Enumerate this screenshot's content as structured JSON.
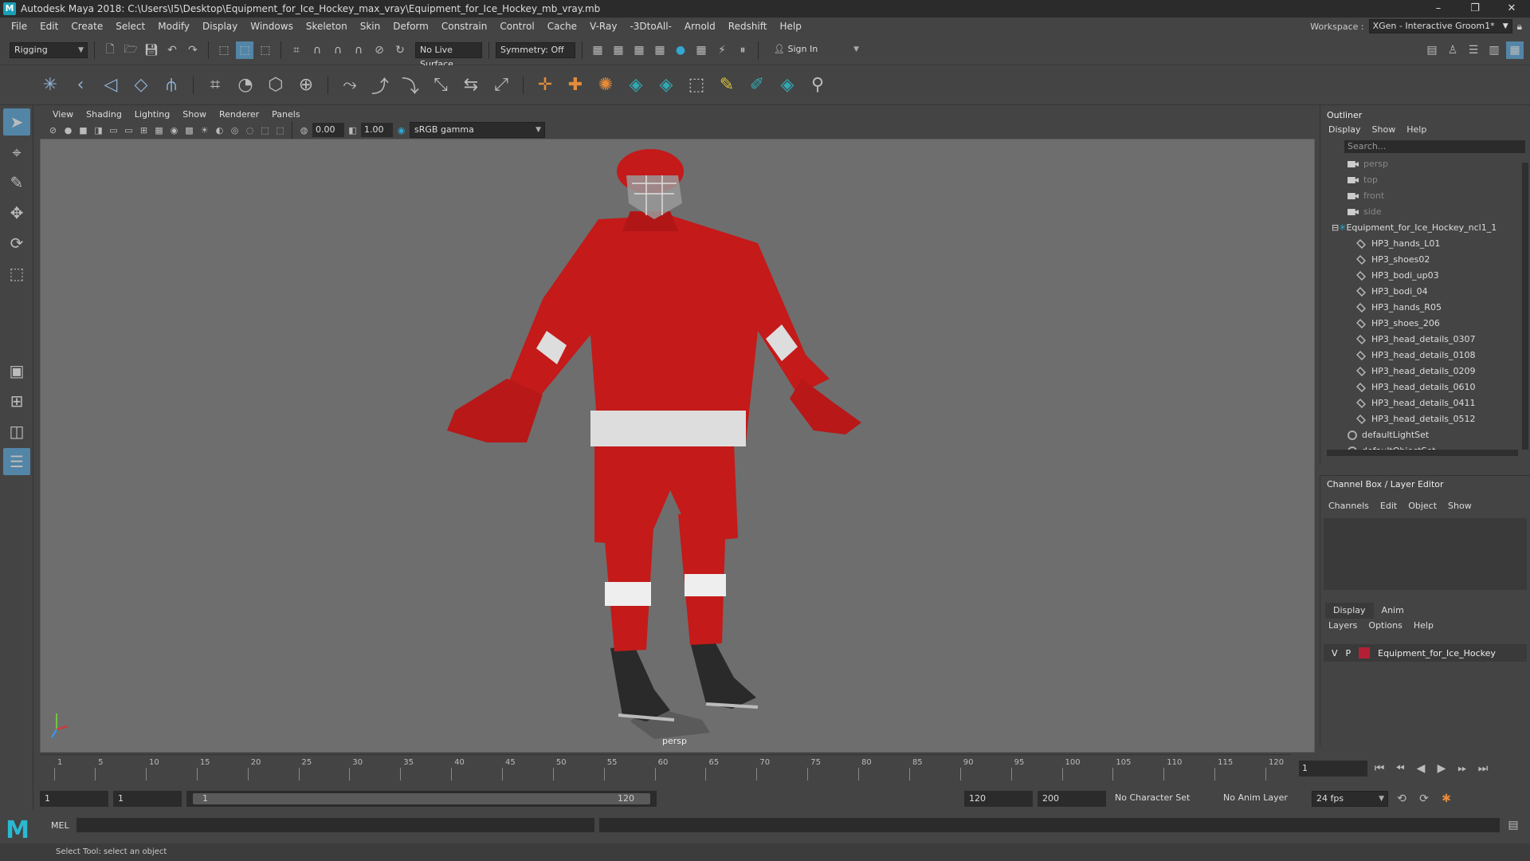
{
  "window": {
    "title": "Autodesk Maya 2018: C:\\Users\\I5\\Desktop\\Equipment_for_Ice_Hockey_max_vray\\Equipment_for_Ice_Hockey_mb_vray.mb",
    "minimize": "–",
    "maximize": "❐",
    "close": "✕"
  },
  "menu": [
    "File",
    "Edit",
    "Create",
    "Select",
    "Modify",
    "Display",
    "Windows",
    "Skeleton",
    "Skin",
    "Deform",
    "Constrain",
    "Control",
    "Cache",
    "V-Ray",
    "-3DtoAll-",
    "Arnold",
    "Redshift",
    "Help"
  ],
  "workspace": {
    "label": "Workspace :",
    "value": "XGen - Interactive Groom1*"
  },
  "status": {
    "mode": "Rigging",
    "live_surface": "No Live Surface",
    "symmetry": "Symmetry: Off",
    "sign_in": "Sign In"
  },
  "viewport": {
    "menu": [
      "View",
      "Shading",
      "Lighting",
      "Show",
      "Renderer",
      "Panels"
    ],
    "exposure": "0.00",
    "gamma": "1.00",
    "color_space": "sRGB gamma",
    "camera": "persp"
  },
  "outliner": {
    "title": "Outliner",
    "menu": [
      "Display",
      "Show",
      "Help"
    ],
    "search_placeholder": "Search...",
    "items": [
      {
        "label": "persp",
        "kind": "cam",
        "indent": 0
      },
      {
        "label": "top",
        "kind": "cam",
        "indent": 0
      },
      {
        "label": "front",
        "kind": "cam",
        "indent": 0
      },
      {
        "label": "side",
        "kind": "cam",
        "indent": 0
      },
      {
        "label": "Equipment_for_Ice_Hockey_ncl1_1",
        "kind": "group",
        "indent": 0
      },
      {
        "label": "HP3_hands_L01",
        "kind": "mesh",
        "indent": 1
      },
      {
        "label": "HP3_shoes02",
        "kind": "mesh",
        "indent": 1
      },
      {
        "label": "HP3_bodi_up03",
        "kind": "mesh",
        "indent": 1
      },
      {
        "label": "HP3_bodi_04",
        "kind": "mesh",
        "indent": 1
      },
      {
        "label": "HP3_hands_R05",
        "kind": "mesh",
        "indent": 1
      },
      {
        "label": "HP3_shoes_206",
        "kind": "mesh",
        "indent": 1
      },
      {
        "label": "HP3_head_details_0307",
        "kind": "mesh",
        "indent": 1
      },
      {
        "label": "HP3_head_details_0108",
        "kind": "mesh",
        "indent": 1
      },
      {
        "label": "HP3_head_details_0209",
        "kind": "mesh",
        "indent": 1
      },
      {
        "label": "HP3_head_details_0610",
        "kind": "mesh",
        "indent": 1
      },
      {
        "label": "HP3_head_details_0411",
        "kind": "mesh",
        "indent": 1
      },
      {
        "label": "HP3_head_details_0512",
        "kind": "mesh",
        "indent": 1
      },
      {
        "label": "defaultLightSet",
        "kind": "set",
        "indent": 0
      },
      {
        "label": "defaultObjectSet",
        "kind": "set",
        "indent": 0
      }
    ]
  },
  "channel_box": {
    "title": "Channel Box / Layer Editor",
    "menu": [
      "Channels",
      "Edit",
      "Object",
      "Show"
    ]
  },
  "layer_editor": {
    "tabs": [
      "Display",
      "Anim"
    ],
    "menu": [
      "Layers",
      "Options",
      "Help"
    ],
    "layer": {
      "v": "V",
      "p": "P",
      "name": "Equipment_for_Ice_Hockey",
      "color": "#b32035"
    }
  },
  "timeline": {
    "ticks": [
      "1",
      "5",
      "10",
      "15",
      "20",
      "25",
      "30",
      "35",
      "40",
      "45",
      "50",
      "55",
      "60",
      "65",
      "70",
      "75",
      "80",
      "85",
      "90",
      "95",
      "100",
      "105",
      "110",
      "115",
      "120"
    ],
    "current_frame": "1"
  },
  "range": {
    "start": "1",
    "playback_start": "1",
    "slider_start": "1",
    "slider_end": "120",
    "playback_end": "120",
    "end": "200",
    "character_set": "No Character Set",
    "anim_layer": "No Anim Layer",
    "fps": "24 fps"
  },
  "command": {
    "label": "MEL"
  },
  "help_line": "Select Tool: select an object",
  "colors": {
    "accent": "#5285a6",
    "jersey": "#c41a1a",
    "viewport_bg": "#6e6e6e"
  }
}
